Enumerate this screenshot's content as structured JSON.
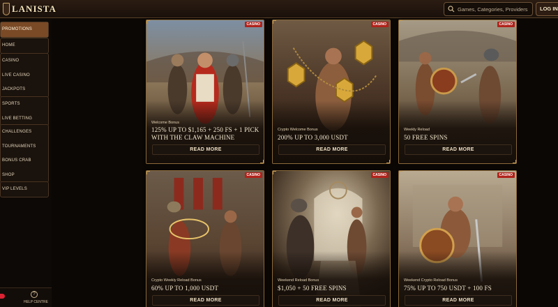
{
  "header": {
    "logo_text": "LANISTA",
    "search_placeholder": "Games, Categories, Providers",
    "login_label": "LOG IN"
  },
  "sidebar": {
    "items": [
      {
        "label": "PROMOTIONS",
        "active": true
      },
      {
        "label": "HOME"
      },
      {
        "label": "CASINO"
      },
      {
        "label": "LIVE CASINO"
      },
      {
        "label": "JACKPOTS"
      },
      {
        "label": "SPORTS"
      },
      {
        "label": "LIVE BETTING"
      },
      {
        "label": "CHALLENGES"
      },
      {
        "label": "TOURNAMENTS"
      },
      {
        "label": "BONUS CRAB"
      },
      {
        "label": "SHOP"
      },
      {
        "label": "VIP LEVELS"
      }
    ],
    "footer": {
      "help_label": "HELP CENTRE"
    }
  },
  "promos": [
    {
      "badge": "CASINO",
      "kind": "Welcome Bonus",
      "offer": "125% up to $1,165 + 250 FS + 1 Pick with the Claw Machine",
      "button": "READ MORE"
    },
    {
      "badge": "CASINO",
      "kind": "Crypto Welcome Bonus",
      "offer": "200% up to 3,000 USDT",
      "button": "READ MORE"
    },
    {
      "badge": "CASINO",
      "kind": "Weekly Reload",
      "offer": "50 Free Spins",
      "button": "READ MORE"
    },
    {
      "badge": "CASINO",
      "kind": "Crypto Weekly Reload Bonus",
      "offer": "60% up to 1,000 USDT",
      "button": "READ MORE"
    },
    {
      "badge": "CASINO",
      "kind": "Weekend Reload Bonus",
      "offer": "$1,050 + 50 Free Spins",
      "button": "READ MORE"
    },
    {
      "badge": "CASINO",
      "kind": "Weekend Crypto Reload Bonus",
      "offer": "75% up to 750 USDT + 100 FS",
      "button": "READ MORE"
    }
  ],
  "colors": {
    "accent": "#7a4a26",
    "badge": "#b0231b",
    "card_border": "#8c6a3a",
    "background": "#0b0705"
  }
}
